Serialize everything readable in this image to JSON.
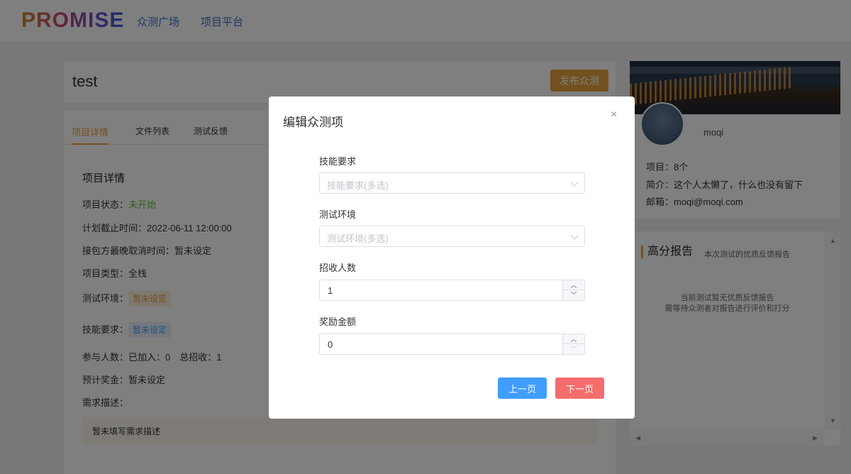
{
  "header": {
    "logo": "PROMISE",
    "nav": [
      "众测广场",
      "项目平台"
    ]
  },
  "project": {
    "title": "test",
    "publish_label": "发布众测",
    "tabs": [
      "项目详情",
      "文件列表",
      "测试反馈"
    ],
    "section_title": "项目详情",
    "status_label": "项目状态：",
    "status_value": "未开始",
    "deadline": "计划截止时间：2022-06-11 12:00:00",
    "cancel_time": "接包方最晚取消时间：暂未设定",
    "type": "项目类型：全栈",
    "env_label": "测试环境：",
    "env_value": "暂未设定",
    "skill_label": "技能要求：",
    "skill_value": "暂未设定",
    "participants": "参与人数：已加入：0　总招收：1",
    "bonus": "预计奖金：暂未设定",
    "desc_label": "需求描述：",
    "desc_value": "暂未填写需求描述"
  },
  "profile": {
    "username": "moqi",
    "projects": "项目：8个",
    "bio": "简介：这个人太懒了，什么也没有留下",
    "email": "邮箱：moqi@moqi.com"
  },
  "report": {
    "title": "高分报告",
    "subtitle": "本次测试的优质反馈报告",
    "empty_line1": "当前测试暂无优质反馈报告",
    "empty_line2": "需等待众测者对报告进行评价和打分"
  },
  "modal": {
    "title": "编辑众测项",
    "close_icon": "×",
    "skill_label": "技能要求",
    "skill_placeholder": "技能要求(多选)",
    "env_label": "测试环境",
    "env_placeholder": "测试环境(多选)",
    "recruit_label": "招收人数",
    "recruit_value": "1",
    "reward_label": "奖励金额",
    "reward_value": "0",
    "prev_label": "上一页",
    "next_label": "下一页"
  },
  "colors": {
    "accent_orange": "#e6a23c",
    "primary_blue": "#409eff",
    "danger_red": "#f56c6c",
    "success_green": "#67c23a"
  }
}
